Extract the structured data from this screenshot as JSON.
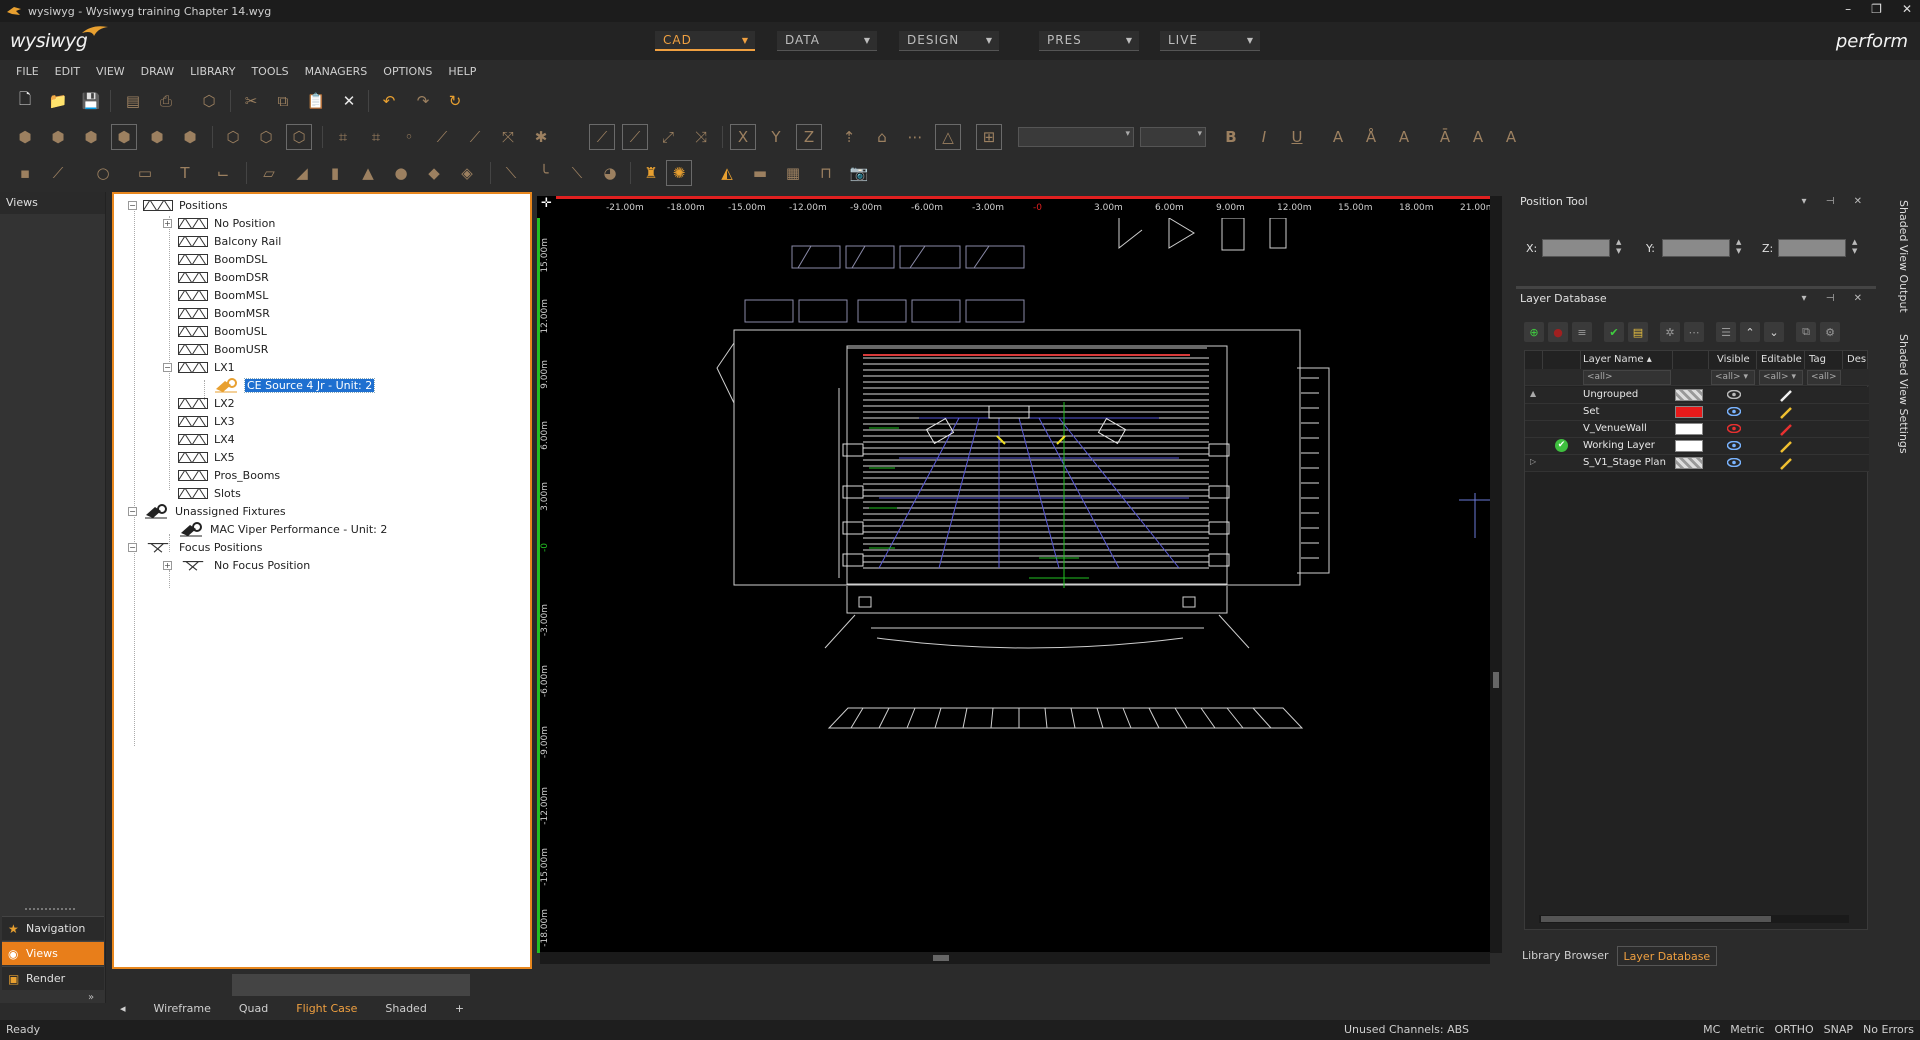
{
  "window": {
    "title": "wysiwyg - Wysiwyg training Chapter 14.wyg",
    "logo_text": "wysiwyg",
    "brand_right": "perform"
  },
  "modes": [
    {
      "label": "CAD",
      "active": true
    },
    {
      "label": "DATA",
      "active": false
    },
    {
      "label": "DESIGN",
      "active": false
    },
    {
      "label": "PRES",
      "active": false
    },
    {
      "label": "LIVE",
      "active": false
    }
  ],
  "menu": [
    "FILE",
    "EDIT",
    "VIEW",
    "DRAW",
    "LIBRARY",
    "TOOLS",
    "MANAGERS",
    "OPTIONS",
    "HELP"
  ],
  "toolbar": {
    "coord_letters": [
      "X",
      "Y",
      "Z"
    ],
    "text_tools": [
      "B",
      "I",
      "U"
    ]
  },
  "leftrail": {
    "header": "Views",
    "buttons": [
      {
        "label": "Navigation",
        "icon": "star-icon",
        "active": false
      },
      {
        "label": "Views",
        "icon": "views-icon",
        "active": true
      },
      {
        "label": "Render",
        "icon": "render-icon",
        "active": false
      }
    ]
  },
  "tree": {
    "rows": [
      {
        "label": "Positions",
        "level": 0,
        "toggle": "−",
        "icon": "truss"
      },
      {
        "label": "No Position",
        "level": 1,
        "toggle": "+",
        "icon": "truss"
      },
      {
        "label": "Balcony Rail",
        "level": 1,
        "toggle": "",
        "icon": "truss"
      },
      {
        "label": "BoomDSL",
        "level": 1,
        "toggle": "",
        "icon": "truss"
      },
      {
        "label": "BoomDSR",
        "level": 1,
        "toggle": "",
        "icon": "truss"
      },
      {
        "label": "BoomMSL",
        "level": 1,
        "toggle": "",
        "icon": "truss"
      },
      {
        "label": "BoomMSR",
        "level": 1,
        "toggle": "",
        "icon": "truss"
      },
      {
        "label": "BoomUSL",
        "level": 1,
        "toggle": "",
        "icon": "truss"
      },
      {
        "label": "BoomUSR",
        "level": 1,
        "toggle": "",
        "icon": "truss"
      },
      {
        "label": "LX1",
        "level": 1,
        "toggle": "−",
        "icon": "truss"
      },
      {
        "label": "CE Source 4 Jr - Unit: 2",
        "level": 2,
        "toggle": "",
        "icon": "fixture-orange",
        "selected": true
      },
      {
        "label": "LX2",
        "level": 1,
        "toggle": "",
        "icon": "truss"
      },
      {
        "label": "LX3",
        "level": 1,
        "toggle": "",
        "icon": "truss"
      },
      {
        "label": "LX4",
        "level": 1,
        "toggle": "",
        "icon": "truss"
      },
      {
        "label": "LX5",
        "level": 1,
        "toggle": "",
        "icon": "truss"
      },
      {
        "label": "Pros_Booms",
        "level": 1,
        "toggle": "",
        "icon": "truss"
      },
      {
        "label": "Slots",
        "level": 1,
        "toggle": "",
        "icon": "truss"
      },
      {
        "label": "Unassigned Fixtures",
        "level": 0,
        "toggle": "−",
        "icon": "fixture-dark"
      },
      {
        "label": "MAC Viper Performance - Unit: 2",
        "level": 1,
        "toggle": "",
        "icon": "fixture-dark"
      },
      {
        "label": "Focus Positions",
        "level": 0,
        "toggle": "−",
        "icon": "focus"
      },
      {
        "label": "No Focus Position",
        "level": 1,
        "toggle": "+",
        "icon": "focus"
      }
    ]
  },
  "rulers": {
    "top": [
      "-21.00m",
      "-18.00m",
      "-15.00m",
      "-12.00m",
      "-9.00m",
      "-6.00m",
      "-3.00m",
      "-0",
      "3.00m",
      "6.00m",
      "9.00m",
      "12.00m",
      "15.00m",
      "18.00m",
      "21.00m"
    ],
    "left": [
      "15.00m",
      "12.00m",
      "9.00m",
      "6.00m",
      "3.00m",
      "-0",
      "-3.00m",
      "-6.00m",
      "-9.00m",
      "-12.00m",
      "-15.00m",
      "-18.00m"
    ]
  },
  "viewtabs": [
    {
      "label": "Wireframe",
      "active": false
    },
    {
      "label": "Quad",
      "active": false
    },
    {
      "label": "Flight Case",
      "active": true
    },
    {
      "label": "Shaded",
      "active": false
    },
    {
      "label": "+",
      "active": false
    }
  ],
  "position_tool": {
    "title": "Position Tool",
    "axes": [
      "X:",
      "Y:",
      "Z:"
    ]
  },
  "layer_db": {
    "title": "Layer Database",
    "columns": [
      "Layer Name",
      "Visible",
      "Editable",
      "Tag",
      "Des"
    ],
    "filter_all": "<all>",
    "layers": [
      {
        "name": "Ungrouped",
        "color": "checker",
        "visible": "grey",
        "editable": "white",
        "expand": "▲",
        "active": false
      },
      {
        "name": "Set",
        "color": "#e81a1a",
        "visible": "blue",
        "editable": "yellow",
        "expand": "",
        "active": false
      },
      {
        "name": "V_VenueWall",
        "color": "#ffffff",
        "visible": "red",
        "editable": "red",
        "expand": "",
        "active": false
      },
      {
        "name": "Working Layer",
        "color": "#ffffff",
        "visible": "blue",
        "editable": "yellow",
        "expand": "",
        "active": true
      },
      {
        "name": "S_V1_Stage Plan",
        "color": "checker",
        "visible": "blue",
        "editable": "yellow",
        "expand": "▷",
        "active": false
      }
    ]
  },
  "bottom_tabs": [
    {
      "label": "Library Browser",
      "active": false
    },
    {
      "label": "Layer Database",
      "active": true
    }
  ],
  "side_rail": [
    "Shaded View Output",
    "Shaded View Settings"
  ],
  "status": {
    "left": "Ready",
    "mid": "Unused Channels: ABS",
    "right": [
      "MC",
      "Metric",
      "ORTHO",
      "SNAP",
      "No Errors"
    ]
  },
  "colors": {
    "accent": "#e8871e",
    "ruler_x": "#e02020",
    "ruler_y": "#22c022"
  }
}
